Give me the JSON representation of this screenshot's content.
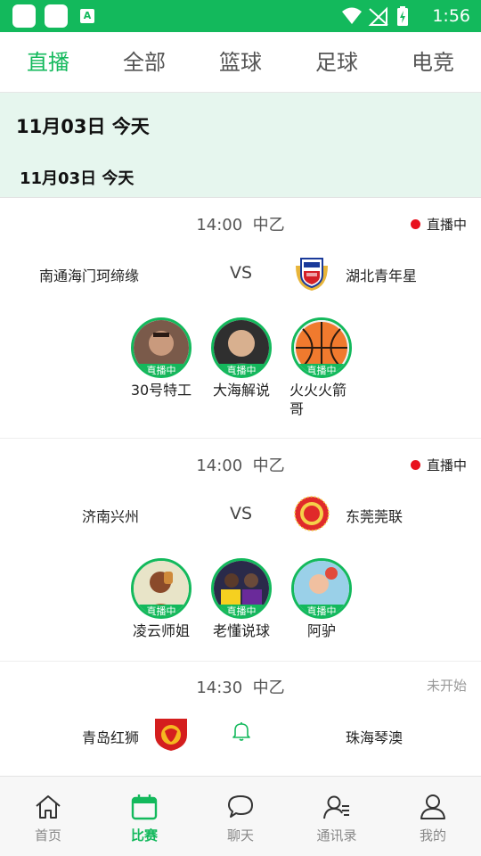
{
  "status_bar": {
    "time": "1:56"
  },
  "tabs": [
    "直播",
    "全部",
    "篮球",
    "足球",
    "电竞"
  ],
  "active_tab": 0,
  "date_header": {
    "primary": "11月03日  今天",
    "secondary": "11月03日    今天"
  },
  "matches": [
    {
      "time": "14:00",
      "league": "中乙",
      "status": "直播中",
      "home": "南通海门珂缔缘",
      "away": "湖北青年星",
      "vs": "VS",
      "anchors": [
        {
          "name": "30号特工",
          "badge": "直播中"
        },
        {
          "name": "大海解说",
          "badge": "直播中"
        },
        {
          "name": "火火火箭哥",
          "badge": "直播中"
        }
      ]
    },
    {
      "time": "14:00",
      "league": "中乙",
      "status": "直播中",
      "home": "济南兴州",
      "away": "东莞莞联",
      "vs": "VS",
      "anchors": [
        {
          "name": "凌云师姐",
          "badge": "直播中"
        },
        {
          "name": "老懂说球",
          "badge": "直播中"
        },
        {
          "name": "阿驴",
          "badge": "直播中"
        }
      ]
    },
    {
      "time": "14:30",
      "league": "中乙",
      "status": "未开始",
      "home": "青岛红狮",
      "away": "珠海琴澳"
    }
  ],
  "bottom_nav": [
    {
      "label": "首页",
      "icon": "home-icon"
    },
    {
      "label": "比赛",
      "icon": "calendar-icon"
    },
    {
      "label": "聊天",
      "icon": "chat-bubble-icon"
    },
    {
      "label": "通讯录",
      "icon": "contacts-icon"
    },
    {
      "label": "我的",
      "icon": "user-icon"
    }
  ],
  "active_nav": 1,
  "colors": {
    "accent": "#13b95c",
    "live_dot": "#e8101c",
    "date_band": "#e6f6ee"
  }
}
